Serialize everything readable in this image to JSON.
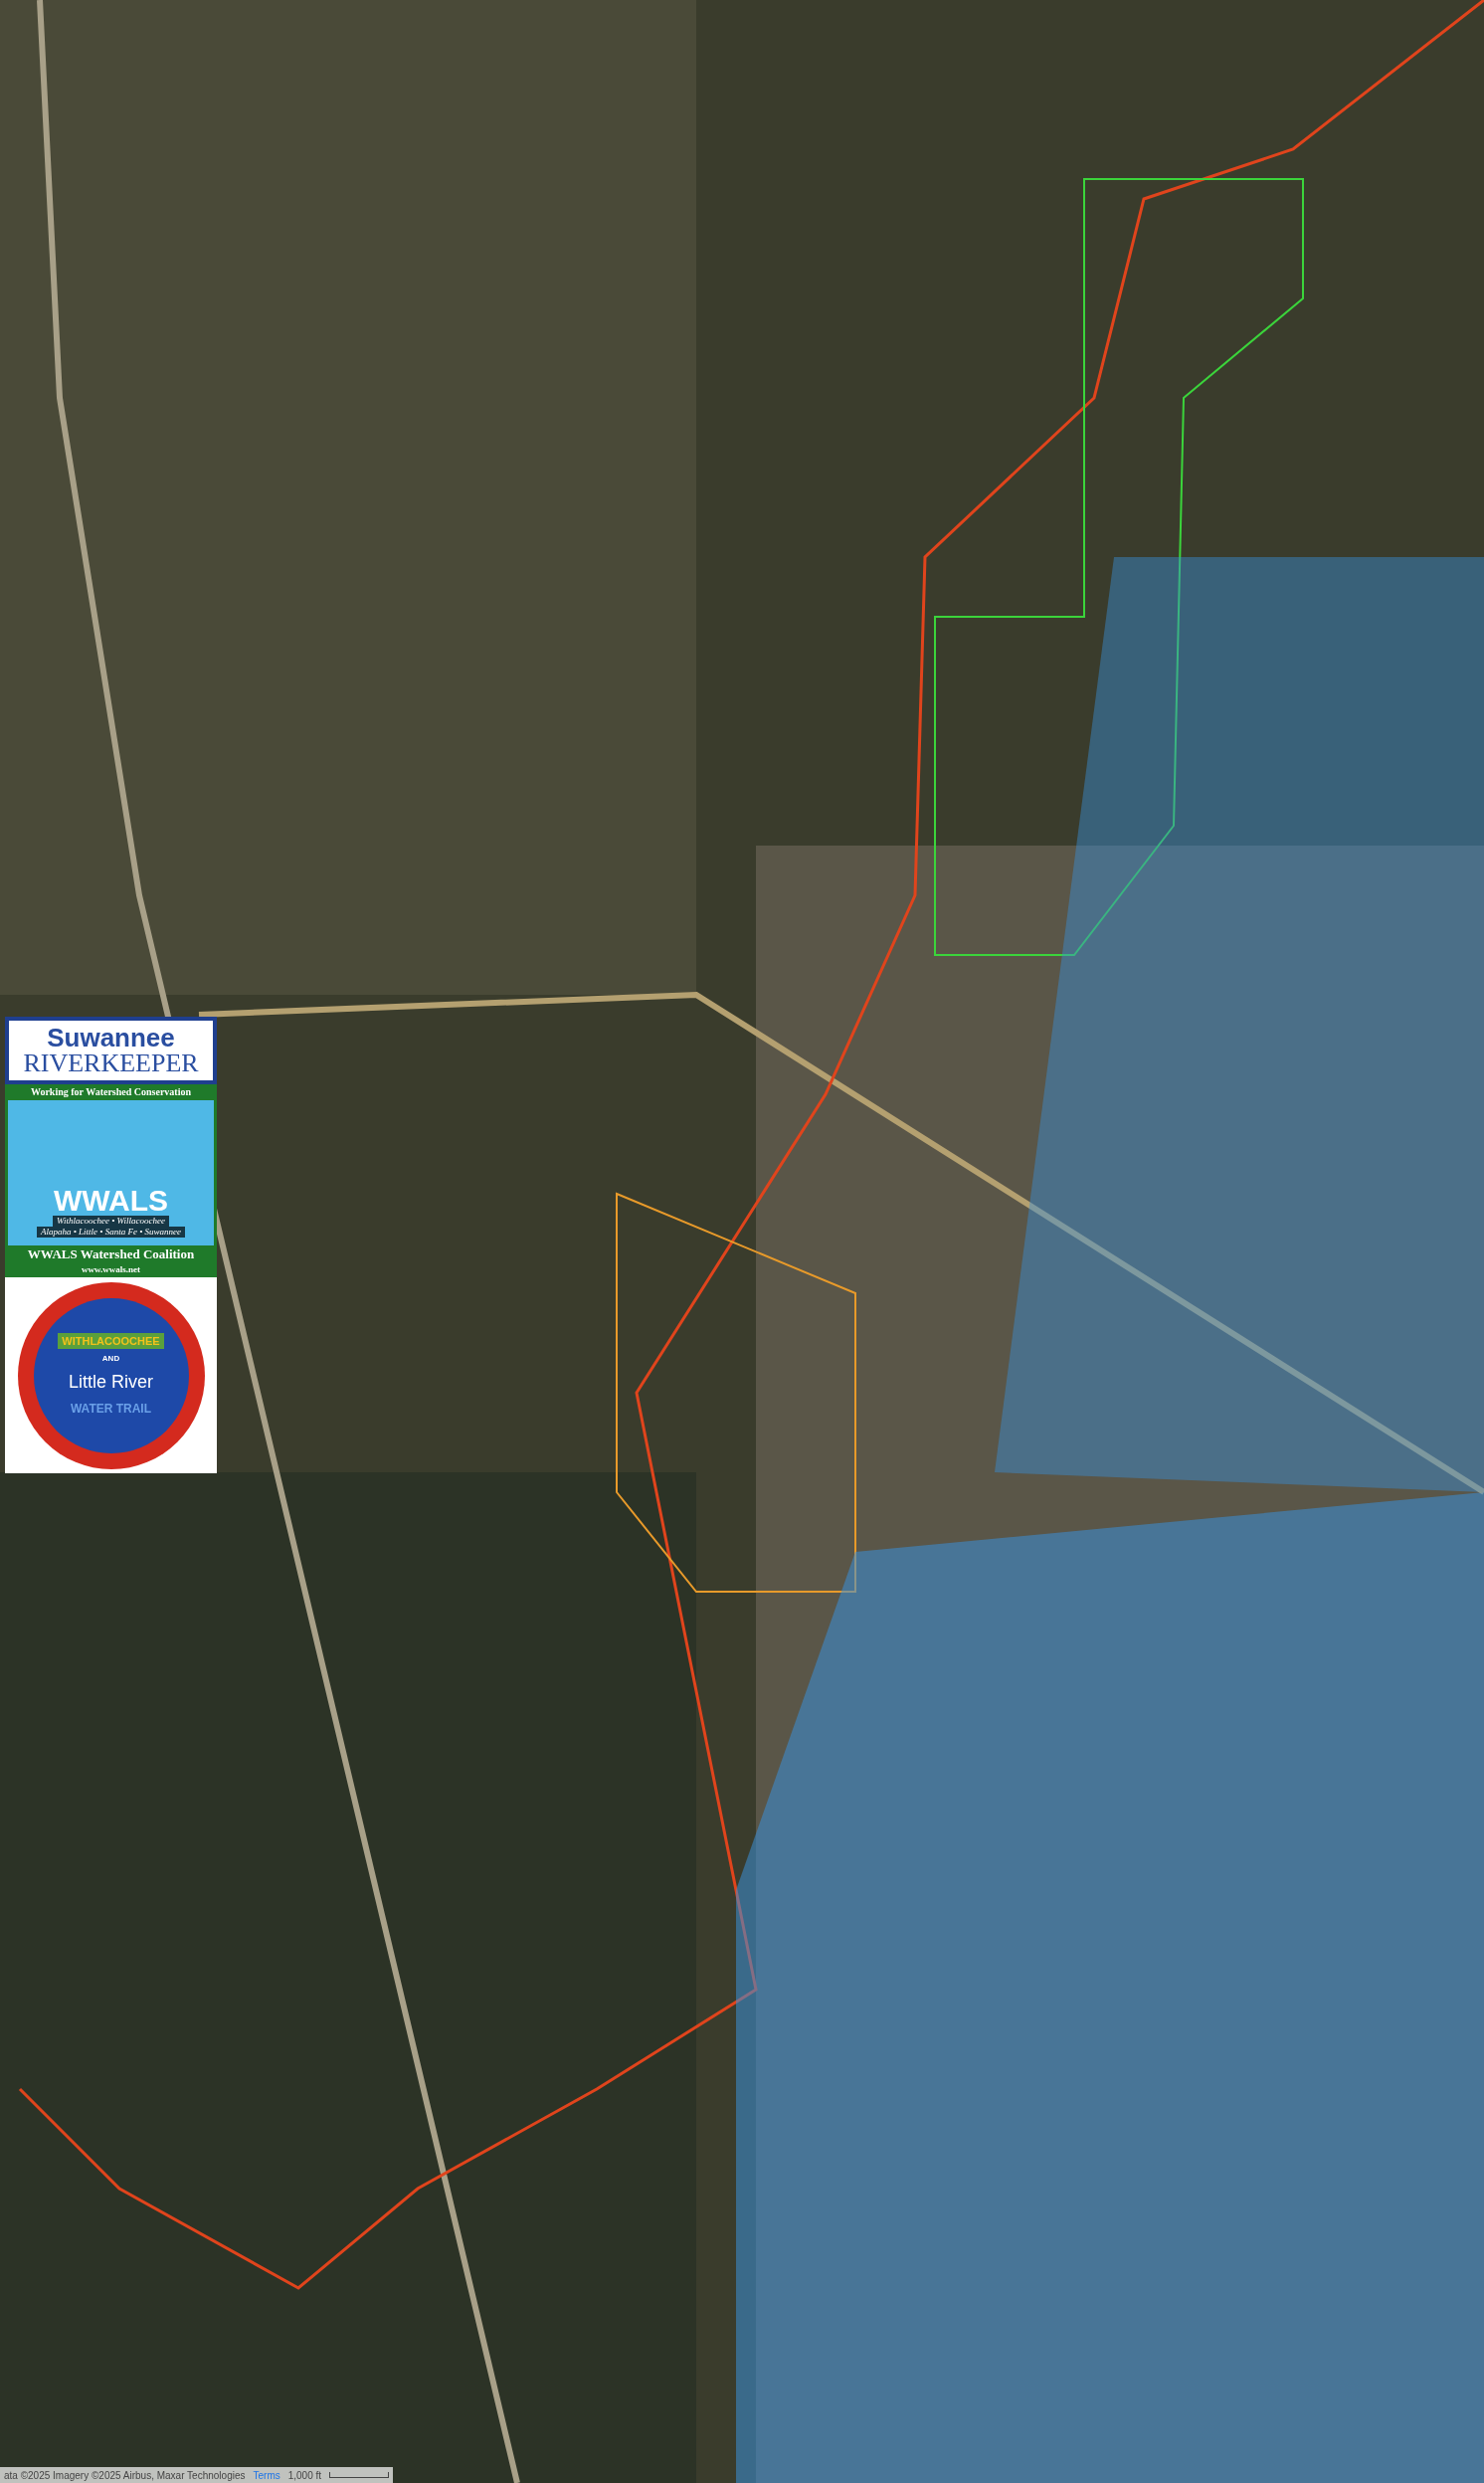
{
  "legend_panel": {
    "riverkeeper": {
      "line_1": "Suwannee",
      "line_2": "RIVERKEEPER",
      "tagline": "Working for Watershed Conservation"
    },
    "wwals": {
      "title": "WWALS",
      "rivers_1": "Withlacoochee • Willacoochee",
      "rivers_2": "Alapaha • Little • Santa Fe • Suwannee",
      "name": "WWALS Watershed Coalition",
      "url": "www.wwals.net"
    },
    "water_trail": {
      "top": "WITHLACOOCHEE",
      "middle": "AND",
      "name": "Little River",
      "bottom": "WATER TRAIL"
    }
  },
  "attribution": {
    "text": "ata ©2025 Imagery ©2025 Airbus, Maxar Technologies",
    "terms": "Terms",
    "scale": "1,000 ft"
  }
}
